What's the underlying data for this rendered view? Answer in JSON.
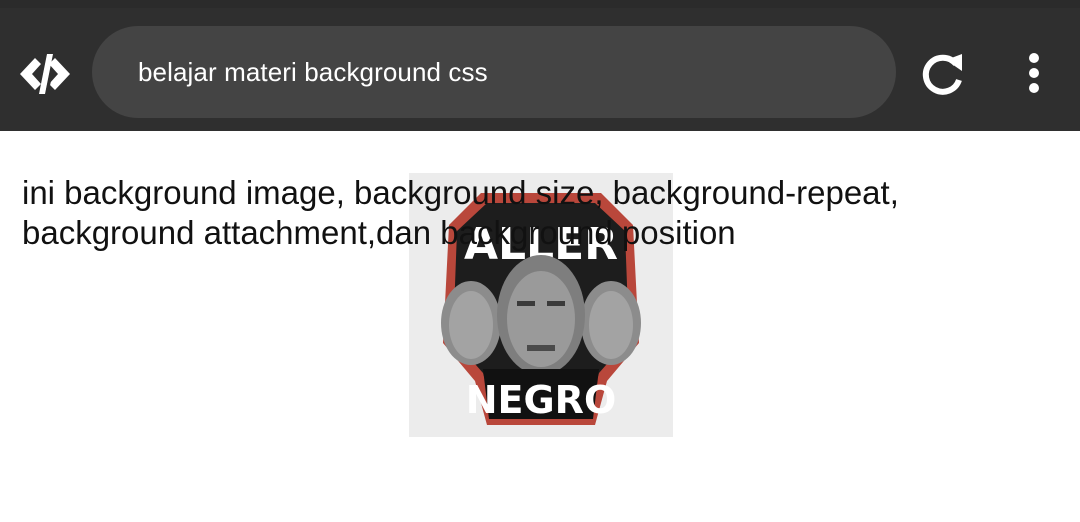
{
  "browser": {
    "url_text": "belajar materi background css",
    "logo_icon": "code-bracket-logo-icon",
    "reload_icon": "reload-icon",
    "menu_icon": "more-vertical-icon",
    "toolbar_color": "#2f2f2f",
    "url_bar_color": "#444444"
  },
  "page": {
    "paragraph": "ini background image, background size, background-repeat, background attachment,dan background position",
    "background_image": {
      "word_top": "ALLER",
      "word_bottom": "NEGRO"
    },
    "background_color": "#ffffff",
    "text_color": "#111111"
  }
}
